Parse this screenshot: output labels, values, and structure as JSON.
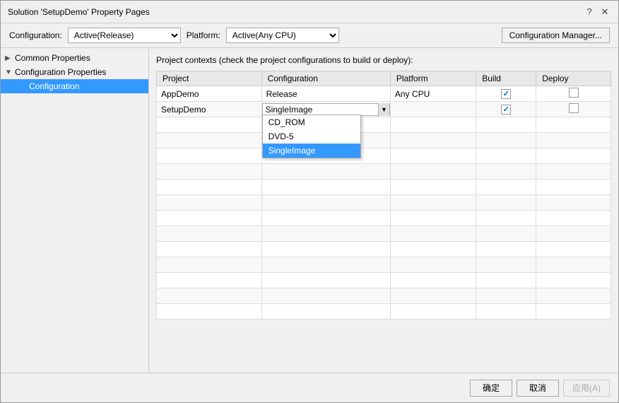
{
  "dialog": {
    "title": "Solution 'SetupDemo' Property Pages",
    "help_icon": "?",
    "close_icon": "✕"
  },
  "toolbar": {
    "configuration_label": "Configuration:",
    "configuration_value": "Active(Release)",
    "platform_label": "Platform:",
    "platform_value": "Active(Any CPU)",
    "config_manager_label": "Configuration Manager..."
  },
  "sidebar": {
    "items": [
      {
        "id": "common-properties",
        "label": "Common Properties",
        "level": 0,
        "expanded": false,
        "arrow": "▶"
      },
      {
        "id": "configuration-properties",
        "label": "Configuration Properties",
        "level": 0,
        "expanded": true,
        "arrow": "▼"
      },
      {
        "id": "configuration",
        "label": "Configuration",
        "level": 1,
        "selected": true
      }
    ]
  },
  "panel": {
    "description": "Project contexts (check the project configurations to build or deploy):",
    "table": {
      "columns": [
        "Project",
        "Configuration",
        "Platform",
        "Build",
        "Deploy"
      ],
      "rows": [
        {
          "project": "AppDemo",
          "configuration": "Release",
          "platform": "Any CPU",
          "build": true,
          "deploy": false
        },
        {
          "project": "SetupDemo",
          "configuration": "SingleImage",
          "platform": "",
          "build": true,
          "deploy": false,
          "has_dropdown": true
        }
      ],
      "dropdown_options": [
        "CD_ROM",
        "DVD-5",
        "SingleImage"
      ],
      "dropdown_selected": "SingleImage"
    }
  },
  "footer": {
    "ok_label": "确定",
    "cancel_label": "取消",
    "apply_label": "应用(A)"
  }
}
